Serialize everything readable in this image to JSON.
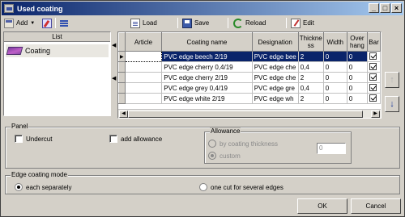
{
  "window": {
    "title": "Used coating"
  },
  "toolbar": {
    "add_label": "Add",
    "load_label": "Load",
    "save_label": "Save",
    "reload_label": "Reload",
    "edit_label": "Edit"
  },
  "list": {
    "header": "List",
    "items": [
      {
        "label": "Coating"
      }
    ]
  },
  "table": {
    "columns": [
      "Article",
      "Coating name",
      "Designation",
      "Thickness",
      "Width",
      "Over hang",
      "Ban"
    ],
    "columns_display": [
      "Article",
      "Coating name",
      "Designation",
      "Thickne ss",
      "Width",
      "Over hang",
      "Bar"
    ],
    "rows": [
      {
        "article": "",
        "name": "PVC edge beech 2/19",
        "designation": "PVC edge bee",
        "thickness": "2",
        "width": "0",
        "overhang": "0",
        "checked": true,
        "selected": true
      },
      {
        "article": "",
        "name": "PVC edge cherry 0,4/19",
        "designation": "PVC edge che",
        "thickness": "0,4",
        "width": "0",
        "overhang": "0",
        "checked": true,
        "selected": false
      },
      {
        "article": "",
        "name": "PVC edge cherry 2/19",
        "designation": "PVC edge che",
        "thickness": "2",
        "width": "0",
        "overhang": "0",
        "checked": true,
        "selected": false
      },
      {
        "article": "",
        "name": "PVC edge grey 0,4/19",
        "designation": "PVC edge gre",
        "thickness": "0,4",
        "width": "0",
        "overhang": "0",
        "checked": true,
        "selected": false
      },
      {
        "article": "",
        "name": "PVC edge white 2/19",
        "designation": "PVC edge wh",
        "thickness": "2",
        "width": "0",
        "overhang": "0",
        "checked": true,
        "selected": false
      }
    ]
  },
  "panel": {
    "label": "Panel",
    "undercut_label": "Undercut",
    "undercut_checked": false,
    "add_allowance_label": "add allowance",
    "add_allowance_checked": false,
    "allowance": {
      "label": "Allowance",
      "option_thickness": "by coating thickness",
      "option_custom": "custom",
      "selected": "custom",
      "value": "0"
    }
  },
  "edge_mode": {
    "label": "Edge coating mode",
    "option_each": "each separately",
    "option_one_cut": "one cut for several edges",
    "selected": "each separately"
  },
  "buttons": {
    "ok": "OK",
    "cancel": "Cancel"
  },
  "colors": {
    "title_start": "#0a246a",
    "title_end": "#a6caf0",
    "selection": "#0a246a",
    "arrow_enabled": "#1a3a9a"
  },
  "icons": [
    "add-icon",
    "pencil-icon",
    "list-icon",
    "load-icon",
    "save-icon",
    "reload-icon",
    "edit-icon",
    "coating-icon",
    "arrow-up-icon",
    "arrow-down-icon"
  ]
}
